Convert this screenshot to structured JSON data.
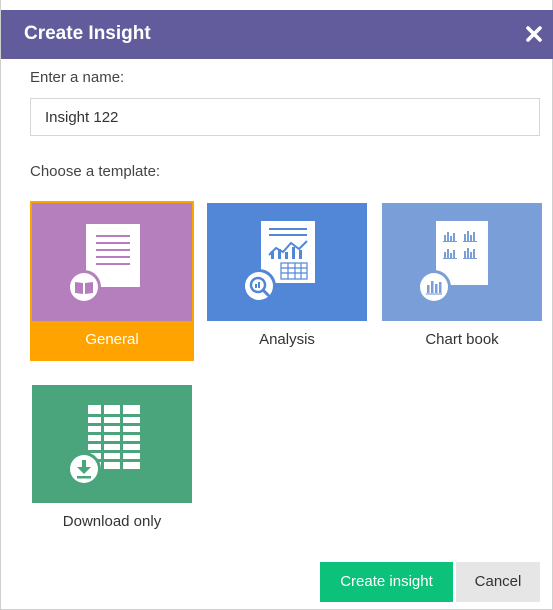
{
  "dialog": {
    "title": "Create Insight",
    "close_icon": "close-icon"
  },
  "name_field": {
    "label": "Enter a name:",
    "value": "Insight 122"
  },
  "template_section": {
    "label": "Choose a template:"
  },
  "templates": [
    {
      "label": "General",
      "icon": "document-book-icon",
      "color": "#b47fbc",
      "selected": true
    },
    {
      "label": "Analysis",
      "icon": "report-magnifier-icon",
      "color": "#5187d6",
      "selected": false
    },
    {
      "label": "Chart book",
      "icon": "chart-book-icon",
      "color": "#7a9fd8",
      "selected": false
    },
    {
      "label": "Download only",
      "icon": "spreadsheet-download-icon",
      "color": "#4aa57c",
      "selected": false
    }
  ],
  "buttons": {
    "create": "Create insight",
    "cancel": "Cancel"
  },
  "colors": {
    "titlebar": "#625c9d",
    "selected_accent": "#ffa300",
    "primary_button": "#0cc27b"
  }
}
